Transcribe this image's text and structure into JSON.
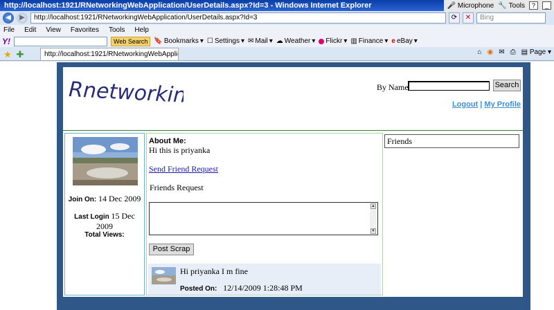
{
  "browser": {
    "title": "http://localhost:1921/RNetworkingWebApplication/UserDetails.aspx?Id=3 - Windows Internet Explorer",
    "title_buttons": [
      "Microphone",
      "Tools"
    ],
    "url": "http://localhost:1921/RNetworkingWebApplication/UserDetails.aspx?Id=3",
    "search_placeholder": "Bing",
    "menu": [
      "File",
      "Edit",
      "View",
      "Favorites",
      "Tools",
      "Help"
    ],
    "yahoo_toolbar": {
      "web_search": "Web Search",
      "items": [
        "Bookmarks",
        "Settings",
        "Mail",
        "Weather",
        "Flickr",
        "Finance",
        "eBay"
      ]
    },
    "tab_title": "http://localhost:1921/RNetworkingWebApplication/Us...",
    "tab_tools": [
      "Page"
    ]
  },
  "page": {
    "logo_text": "Rnetworking",
    "search": {
      "label": "By Name:",
      "value": "",
      "button": "Search"
    },
    "links": {
      "logout": "Logout",
      "separator": "|",
      "profile": "My Profile"
    },
    "user": {
      "join_label": "Join On:",
      "join_date": "14 Dec 2009",
      "last_login_label": "Last Login",
      "last_login_date": "15 Dec 2009",
      "views_label": "Total Views:",
      "views_value": ""
    },
    "about": {
      "label": "About Me:",
      "text": "Hi this is priyanka",
      "send_request": "Send Friend Request",
      "friends_request": "Friends Request"
    },
    "scrap": {
      "input_value": "",
      "post_button": "Post Scrap",
      "items": [
        {
          "text": "Hi priyanka I m fine",
          "posted_label": "Posted On:",
          "posted_value": "12/14/2009 1:28:48 PM"
        }
      ]
    },
    "friends": {
      "title": "Friends"
    }
  },
  "colors": {
    "frame": "#2f5788",
    "link": "#3b8fd6",
    "header_border": "#3a7d3a",
    "scrap_bg": "#e8eef8"
  }
}
